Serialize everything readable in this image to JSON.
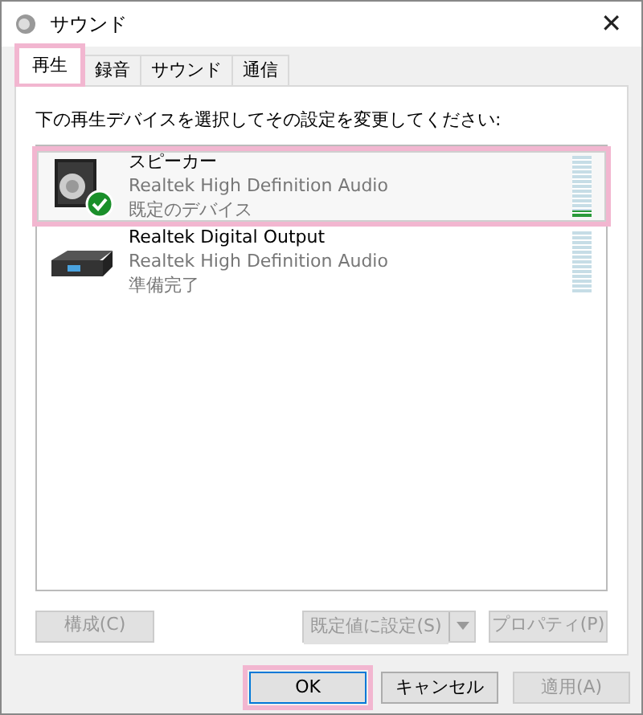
{
  "window": {
    "title": "サウンド",
    "close": "✕"
  },
  "tabs": [
    {
      "label": "再生",
      "selected": true,
      "highlighted": true
    },
    {
      "label": "録音",
      "selected": false,
      "highlighted": false
    },
    {
      "label": "サウンド",
      "selected": false,
      "highlighted": false
    },
    {
      "label": "通信",
      "selected": false,
      "highlighted": false
    }
  ],
  "instruction": "下の再生デバイスを選択してその設定を変更してください:",
  "devices": [
    {
      "kind": "speaker",
      "name": "スピーカー",
      "driver": "Realtek High Definition Audio",
      "status": "既定のデバイス",
      "default": true,
      "selected": true,
      "highlighted": true,
      "level": 0.1
    },
    {
      "kind": "digital",
      "name": "Realtek Digital Output",
      "driver": "Realtek High Definition Audio",
      "status": "準備完了",
      "default": false,
      "selected": false,
      "highlighted": false
    }
  ],
  "panel_buttons": [
    {
      "kind": "button",
      "label": "構成(C)",
      "disabled": true
    },
    {
      "kind": "split",
      "label": "既定値に設定(S)",
      "disabled": true
    },
    {
      "kind": "button",
      "label": "プロパティ(P)",
      "disabled": true
    }
  ],
  "dialog_buttons": [
    {
      "label": "OK",
      "disabled": false,
      "default": true,
      "highlighted": true
    },
    {
      "label": "キャンセル",
      "disabled": false,
      "default": false,
      "highlighted": false
    },
    {
      "label": "適用(A)",
      "disabled": true,
      "default": false,
      "highlighted": false
    }
  ]
}
